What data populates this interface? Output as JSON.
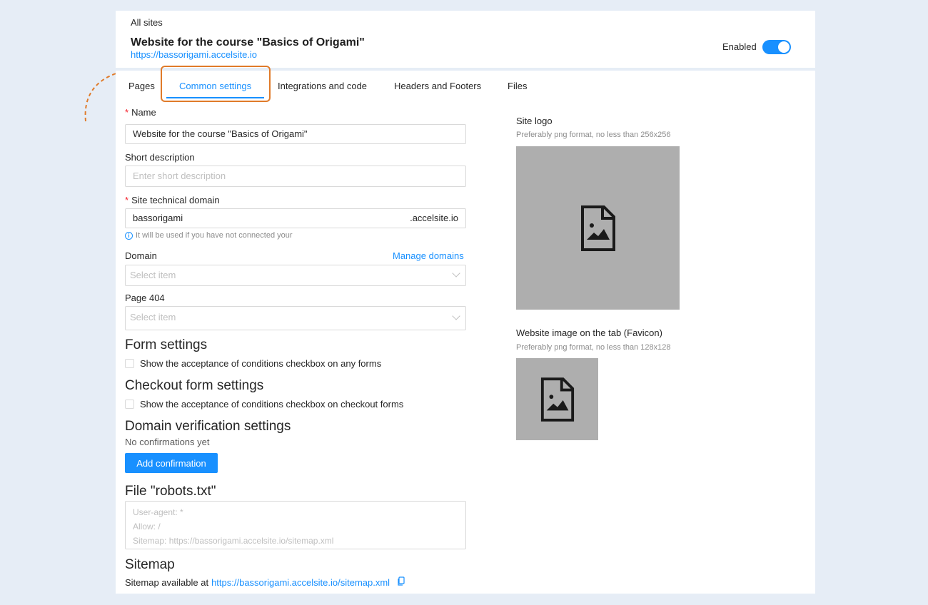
{
  "header": {
    "breadcrumb": "All sites",
    "title": "Website for the course \"Basics of Origami\"",
    "url": "https://bassorigami.accelsite.io",
    "enabled_label": "Enabled",
    "enabled": true
  },
  "tabs": [
    {
      "label": "Pages"
    },
    {
      "label": "Common settings",
      "active": true
    },
    {
      "label": "Integrations and code"
    },
    {
      "label": "Headers and Footers"
    },
    {
      "label": "Files"
    }
  ],
  "form": {
    "name": {
      "label": "Name",
      "value": "Website for the course \"Basics of Origami\"",
      "required": true
    },
    "short_description": {
      "label": "Short description",
      "placeholder": "Enter short description"
    },
    "technical_domain": {
      "label": "Site technical domain",
      "value": "bassorigami",
      "suffix": ".accelsite.io",
      "hint": "It will be used if you have not connected your",
      "required": true
    },
    "domain": {
      "label": "Domain",
      "manage_link": "Manage domains",
      "placeholder": "Select item"
    },
    "page404": {
      "label": "Page 404",
      "placeholder": "Select item"
    }
  },
  "form_settings": {
    "title": "Form settings",
    "checkbox_label": "Show the acceptance of conditions checkbox on any forms"
  },
  "checkout_settings": {
    "title": "Checkout form settings",
    "checkbox_label": "Show the acceptance of conditions checkbox on checkout forms"
  },
  "domain_verification": {
    "title": "Domain verification settings",
    "empty_text": "No confirmations yet",
    "button_label": "Add confirmation"
  },
  "robots": {
    "title": "File \"robots.txt\"",
    "lines": [
      "User-agent: *",
      "Allow: /",
      "Sitemap: https://bassorigami.accelsite.io/sitemap.xml"
    ]
  },
  "sitemap": {
    "title": "Sitemap",
    "prefix": "Sitemap available at",
    "url": "https://bassorigami.accelsite.io/sitemap.xml"
  },
  "site_logo": {
    "label": "Site logo",
    "hint": "Preferably png format, no less than 256x256"
  },
  "favicon": {
    "label": "Website image on the tab (Favicon)",
    "hint": "Preferably png format, no less than 128x128"
  },
  "colors": {
    "accent": "#1890ff",
    "highlight": "#e07b2a",
    "placeholder_bg": "#aeaeae"
  }
}
